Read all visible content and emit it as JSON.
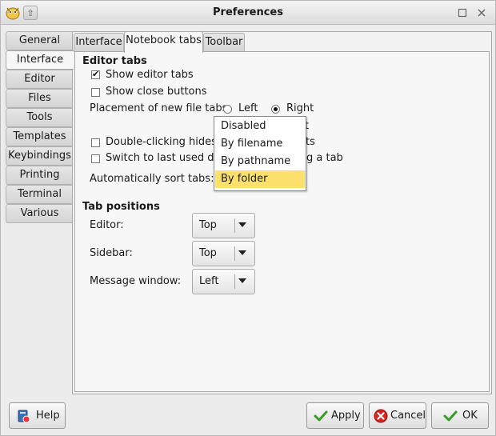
{
  "window": {
    "title": "Preferences"
  },
  "side_tabs": [
    "General",
    "Interface",
    "Editor",
    "Files",
    "Tools",
    "Templates",
    "Keybindings",
    "Printing",
    "Terminal",
    "Various"
  ],
  "top_tabs": [
    "Interface",
    "Notebook tabs",
    "Toolbar"
  ],
  "editor_tabs": {
    "title": "Editor tabs",
    "show_editor_tabs": "Show editor tabs",
    "show_close_buttons": "Show close buttons",
    "placement_label": "Placement of new file tabs:",
    "placement_left": "Left",
    "placement_right": "Right",
    "placement_value": "Right",
    "next_to_current_tail": "t",
    "double_click_label": "Double-clicking hides a",
    "double_click_tail": "ts",
    "switch_last_label": "Switch to last used do",
    "switch_last_tail": "g a tab",
    "auto_sort_label": "Automatically sort tabs:"
  },
  "sort_popup": {
    "options": [
      "Disabled",
      "By filename",
      "By pathname",
      "By folder"
    ],
    "selected": "By folder",
    "highlight_color": "#fbe16c"
  },
  "tab_positions": {
    "title": "Tab positions",
    "editor_label": "Editor:",
    "editor_value": "Top",
    "sidebar_label": "Sidebar:",
    "sidebar_value": "Top",
    "message_label": "Message window:",
    "message_value": "Left"
  },
  "buttons": {
    "help": "Help",
    "apply": "Apply",
    "cancel": "Cancel",
    "ok": "OK"
  },
  "checks": {
    "show_editor_tabs": true,
    "show_close_buttons": false,
    "double_click": false,
    "switch_last": false
  }
}
